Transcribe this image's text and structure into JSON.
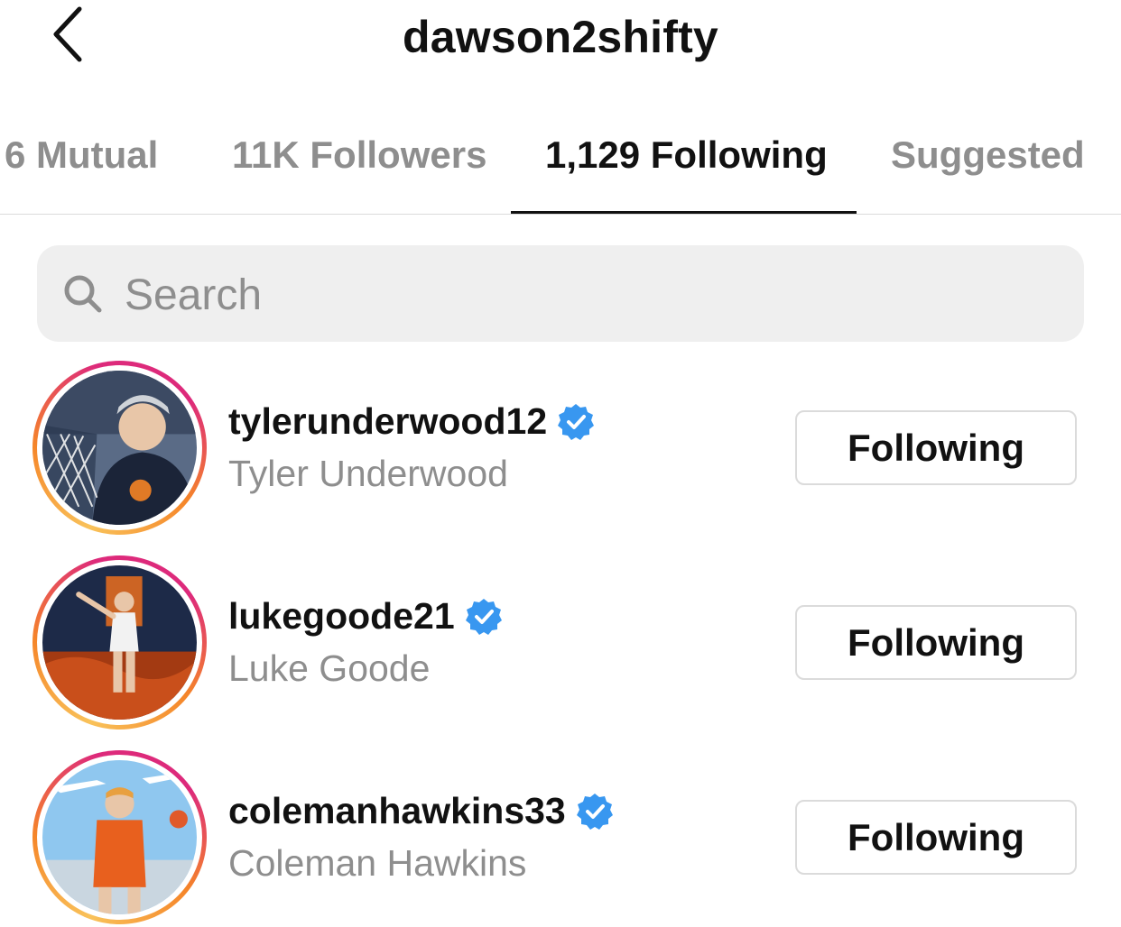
{
  "header": {
    "title": "dawson2shifty",
    "back_icon": "chevron-left-icon"
  },
  "tabs": [
    {
      "label": "6 Mutual",
      "active": false
    },
    {
      "label": "11K Followers",
      "active": false
    },
    {
      "label": "1,129 Following",
      "active": true
    },
    {
      "label": "Suggested",
      "active": false
    }
  ],
  "search": {
    "placeholder": "Search",
    "icon": "search-icon"
  },
  "users": [
    {
      "username": "tylerunderwood12",
      "full_name": "Tyler Underwood",
      "verified": true,
      "button_label": "Following"
    },
    {
      "username": "lukegoode21",
      "full_name": "Luke Goode",
      "verified": true,
      "button_label": "Following"
    },
    {
      "username": "colemanhawkins33",
      "full_name": "Coleman Hawkins",
      "verified": true,
      "button_label": "Following"
    }
  ],
  "colors": {
    "accent": "#111111",
    "muted": "#8e8e8e",
    "verified_blue": "#3897f0",
    "search_bg": "#efefef",
    "story_ring": [
      "#f9c25a",
      "#f58529",
      "#dd2a7b"
    ]
  }
}
